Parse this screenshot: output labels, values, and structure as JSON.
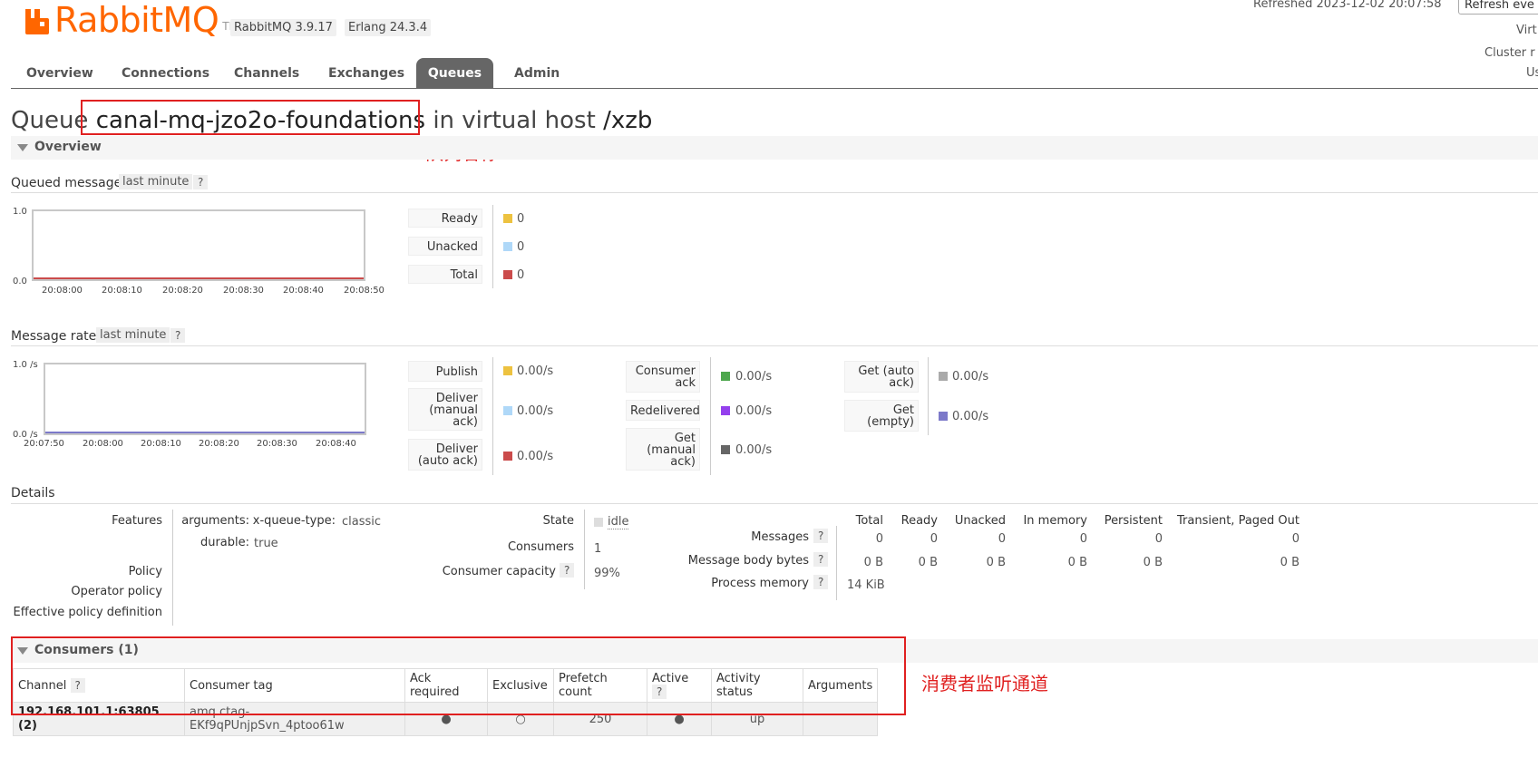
{
  "header": {
    "logo_text": "RabbitMQ",
    "logo_tm": "TM",
    "version": "RabbitMQ 3.9.17",
    "erlang": "Erlang 24.3.4",
    "refreshed": "Refreshed 2023-12-02 20:07:58",
    "refresh_button": "Refresh eve",
    "virtual": "Virt",
    "cluster": "Cluster r",
    "user": "Us"
  },
  "nav": {
    "items": [
      "Overview",
      "Connections",
      "Channels",
      "Exchanges",
      "Queues",
      "Admin"
    ],
    "active": "Queues"
  },
  "title": {
    "prefix": "Queue",
    "queue_name": "canal-mq-jzo2o-foundations",
    "middle": "in virtual host",
    "vhost": "/xzb"
  },
  "annotations": {
    "queue_name": "队列名称",
    "consumers": "消费者监听通道"
  },
  "overview": {
    "label": "Overview",
    "queued": {
      "label": "Queued messages",
      "range": "last minute",
      "help": "?",
      "y_max": "1.0",
      "y_min": "0.0",
      "x_ticks": [
        "20:08:00",
        "20:08:10",
        "20:08:20",
        "20:08:30",
        "20:08:40",
        "20:08:50"
      ],
      "legend": [
        {
          "label": "Ready",
          "value": "0",
          "color": "#edc240"
        },
        {
          "label": "Unacked",
          "value": "0",
          "color": "#afd8f8"
        },
        {
          "label": "Total",
          "value": "0",
          "color": "#cb4b4b"
        }
      ]
    },
    "rates": {
      "label": "Message rates",
      "range": "last minute",
      "help": "?",
      "y_max": "1.0 /s",
      "y_min": "0.0 /s",
      "x_ticks": [
        "20:07:50",
        "20:08:00",
        "20:08:10",
        "20:08:20",
        "20:08:30",
        "20:08:40"
      ],
      "col1": [
        {
          "label": "Publish",
          "value": "0.00/s",
          "color": "#edc240"
        },
        {
          "label": "Deliver (manual ack)",
          "value": "0.00/s",
          "color": "#afd8f8"
        },
        {
          "label": "Deliver (auto ack)",
          "value": "0.00/s",
          "color": "#cb4b4b"
        }
      ],
      "col2": [
        {
          "label": "Consumer ack",
          "value": "0.00/s",
          "color": "#4da74d"
        },
        {
          "label": "Redelivered",
          "value": "0.00/s",
          "color": "#9440ed"
        },
        {
          "label": "Get (manual ack)",
          "value": "0.00/s",
          "color": "#666666"
        }
      ],
      "col3": [
        {
          "label": "Get (auto ack)",
          "value": "0.00/s",
          "color": "#aaaaaa"
        },
        {
          "label": "Get (empty)",
          "value": "0.00/s",
          "color": "#7c79c9"
        }
      ]
    }
  },
  "details": {
    "label": "Details",
    "features_key": "Features",
    "arguments_key": "arguments:",
    "arguments_sub": "x-queue-type:",
    "arguments_val": "classic",
    "durable_key": "durable:",
    "durable_val": "true",
    "policy_key": "Policy",
    "operator_policy_key": "Operator policy",
    "effective_policy_key": "Effective policy definition",
    "state_key": "State",
    "state_val": "idle",
    "consumers_key": "Consumers",
    "consumers_val": "1",
    "capacity_key": "Consumer capacity",
    "capacity_val": "99%",
    "help": "?",
    "stats_headers": [
      "Total",
      "Ready",
      "Unacked",
      "In memory",
      "Persistent",
      "Transient, Paged Out"
    ],
    "messages_key": "Messages",
    "messages_vals": [
      "0",
      "0",
      "0",
      "0",
      "0",
      "0"
    ],
    "body_bytes_key": "Message body bytes",
    "body_bytes_vals": [
      "0 B",
      "0 B",
      "0 B",
      "0 B",
      "0 B",
      "0 B"
    ],
    "process_memory_key": "Process memory",
    "process_memory_val": "14 KiB"
  },
  "consumers": {
    "label": "Consumers (1)",
    "headers": {
      "channel": "Channel",
      "tag": "Consumer tag",
      "ack": "Ack required",
      "exclusive": "Exclusive",
      "prefetch": "Prefetch count",
      "active": "Active",
      "activity": "Activity status",
      "arguments": "Arguments",
      "help": "?"
    },
    "rows": [
      {
        "channel": "192.168.101.1:63805 (2)",
        "tag": "amq.ctag-EKf9qPUnjpSvn_4ptoo61w",
        "ack": "●",
        "exclusive": "○",
        "prefetch": "250",
        "active": "●",
        "activity": "up",
        "arguments": ""
      }
    ]
  }
}
